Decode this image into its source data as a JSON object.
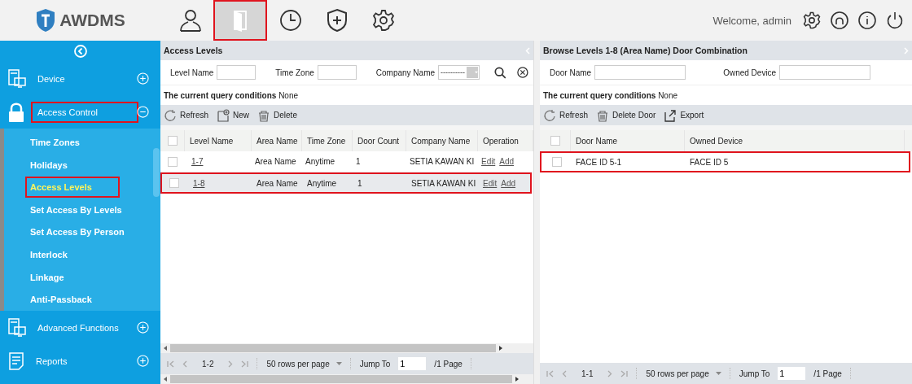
{
  "header": {
    "logo": "AWDMS",
    "nav": [
      {
        "selected": false,
        "highlighted": false
      },
      {
        "selected": true,
        "highlighted": true
      },
      {
        "selected": false,
        "highlighted": false
      },
      {
        "selected": false,
        "highlighted": false
      },
      {
        "selected": false,
        "highlighted": false
      }
    ],
    "welcome": "Welcome, admin"
  },
  "sidebar": {
    "modules": [
      {
        "label": "Device",
        "expanded": false,
        "highlighted": false
      },
      {
        "label": "Access Control",
        "expanded": true,
        "highlighted": true,
        "children": [
          {
            "label": "Time Zones",
            "selected": false,
            "highlighted": false
          },
          {
            "label": "Holidays",
            "selected": false,
            "highlighted": false
          },
          {
            "label": "Access Levels",
            "selected": true,
            "highlighted": true
          },
          {
            "label": "Set Access By Levels",
            "selected": false,
            "highlighted": false
          },
          {
            "label": "Set Access By Person",
            "selected": false,
            "highlighted": false
          },
          {
            "label": "Interlock",
            "selected": false,
            "highlighted": false
          },
          {
            "label": "Linkage",
            "selected": false,
            "highlighted": false
          },
          {
            "label": "Anti-Passback",
            "selected": false,
            "highlighted": false
          }
        ]
      },
      {
        "label": "Advanced Functions",
        "expanded": false,
        "highlighted": false
      },
      {
        "label": "Reports",
        "expanded": false,
        "highlighted": false
      }
    ]
  },
  "panels": [
    {
      "title": "Access Levels",
      "filters": [
        {
          "label": "Level Name",
          "kind": "text"
        },
        {
          "label": "Time Zone",
          "kind": "text"
        },
        {
          "label": "Company Name",
          "kind": "select",
          "value": "----------"
        }
      ],
      "query_label": "The current query conditions",
      "query_value": "None",
      "toolbar": [
        "Refresh",
        "New",
        "Delete"
      ],
      "select_all_checked": false,
      "columns": [
        "Level Name",
        "Area Name",
        "Time Zone",
        "Door Count",
        "Company Name",
        "Operation"
      ],
      "rows": [
        {
          "cells": [
            "1-7",
            "Area Name",
            "Anytime",
            "1",
            "SETIA KAWAN KI"
          ],
          "actions": [
            "Edit",
            "Add"
          ],
          "highlighted": false,
          "selected": false,
          "checked": false
        },
        {
          "cells": [
            "1-8",
            "Area Name",
            "Anytime",
            "1",
            "SETIA KAWAN KI"
          ],
          "actions": [
            "Edit",
            "Add"
          ],
          "highlighted": true,
          "selected": true,
          "checked": false
        }
      ],
      "pagination": {
        "range": "1-2",
        "per_page": "50 rows per page",
        "jump_label": "Jump To",
        "page": "1",
        "total": "/1 Page"
      }
    },
    {
      "title": "Browse Levels 1-8  (Area Name)  Door Combination",
      "filters": [
        {
          "label": "Door Name",
          "kind": "text"
        },
        {
          "label": "Owned Device",
          "kind": "text"
        }
      ],
      "query_label": "The current query conditions",
      "query_value": "None",
      "toolbar": [
        "Refresh",
        "Delete Door",
        "Export"
      ],
      "select_all_checked": false,
      "columns": [
        "Door Name",
        "Owned Device"
      ],
      "rows": [
        {
          "cells": [
            "FACE ID 5-1",
            "FACE ID 5"
          ],
          "highlighted": true,
          "selected": false,
          "checked": false
        }
      ],
      "pagination": {
        "range": "1-1",
        "per_page": "50 rows per page",
        "jump_label": "Jump To",
        "page": "1",
        "total": "/1 Page"
      }
    }
  ]
}
